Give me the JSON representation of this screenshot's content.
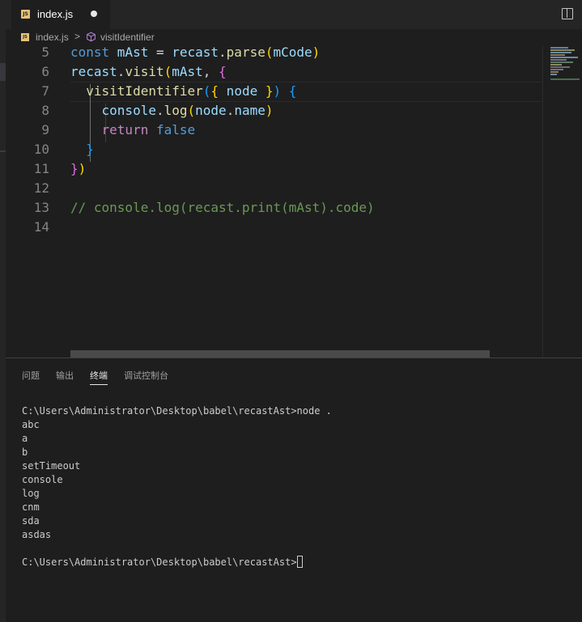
{
  "tab": {
    "filename": "index.js",
    "icon_text": "JS"
  },
  "breadcrumb": {
    "file": "index.js",
    "separator": ">",
    "symbol": "visitIdentifier"
  },
  "code_lines": [
    {
      "num": "5",
      "tokens": [
        {
          "t": "const ",
          "c": "k-kw"
        },
        {
          "t": "mAst",
          "c": "k-var"
        },
        {
          "t": " = ",
          "c": "k-p"
        },
        {
          "t": "recast",
          "c": "k-var"
        },
        {
          "t": ".",
          "c": "k-p"
        },
        {
          "t": "parse",
          "c": "k-fn"
        },
        {
          "t": "(",
          "c": "k-b1"
        },
        {
          "t": "mCode",
          "c": "k-var"
        },
        {
          "t": ")",
          "c": "k-b1"
        }
      ]
    },
    {
      "num": "6",
      "tokens": [
        {
          "t": "recast",
          "c": "k-var"
        },
        {
          "t": ".",
          "c": "k-p"
        },
        {
          "t": "visit",
          "c": "k-fn"
        },
        {
          "t": "(",
          "c": "k-b1"
        },
        {
          "t": "mAst",
          "c": "k-var"
        },
        {
          "t": ", ",
          "c": "k-p"
        },
        {
          "t": "{",
          "c": "k-b2"
        }
      ]
    },
    {
      "num": "7",
      "tokens": [
        {
          "t": "  visitIdentifier",
          "c": "k-fn"
        },
        {
          "t": "(",
          "c": "k-b3"
        },
        {
          "t": "{",
          "c": "k-b1"
        },
        {
          "t": " node ",
          "c": "k-var"
        },
        {
          "t": "}",
          "c": "k-b1"
        },
        {
          "t": ")",
          "c": "k-b3"
        },
        {
          "t": " ",
          "c": "k-p"
        },
        {
          "t": "{",
          "c": "k-b3"
        }
      ]
    },
    {
      "num": "8",
      "tokens": [
        {
          "t": "    console",
          "c": "k-var"
        },
        {
          "t": ".",
          "c": "k-p"
        },
        {
          "t": "log",
          "c": "k-fn"
        },
        {
          "t": "(",
          "c": "k-b1"
        },
        {
          "t": "node",
          "c": "k-var"
        },
        {
          "t": ".",
          "c": "k-p"
        },
        {
          "t": "name",
          "c": "k-var"
        },
        {
          "t": ")",
          "c": "k-b1"
        }
      ]
    },
    {
      "num": "9",
      "tokens": [
        {
          "t": "    return ",
          "c": "k-ctl"
        },
        {
          "t": "false",
          "c": "k-bool"
        }
      ]
    },
    {
      "num": "10",
      "tokens": [
        {
          "t": "  ",
          "c": "k-p"
        },
        {
          "t": "}",
          "c": "k-b3"
        }
      ]
    },
    {
      "num": "11",
      "tokens": [
        {
          "t": "}",
          "c": "k-b2"
        },
        {
          "t": ")",
          "c": "k-b1"
        }
      ]
    },
    {
      "num": "12",
      "tokens": []
    },
    {
      "num": "13",
      "tokens": [
        {
          "t": "// console.log(recast.print(mAst).code)",
          "c": "k-cm"
        }
      ]
    },
    {
      "num": "14",
      "tokens": []
    }
  ],
  "panel_tabs": [
    "问题",
    "输出",
    "终端",
    "调试控制台"
  ],
  "active_panel_tab": "终端",
  "terminal_lines": [
    "C:\\Users\\Administrator\\Desktop\\babel\\recastAst>node .",
    "abc",
    "a",
    "b",
    "setTimeout",
    "console",
    "log",
    "cnm",
    "sda",
    "asdas",
    "",
    "C:\\Users\\Administrator\\Desktop\\babel\\recastAst>"
  ]
}
